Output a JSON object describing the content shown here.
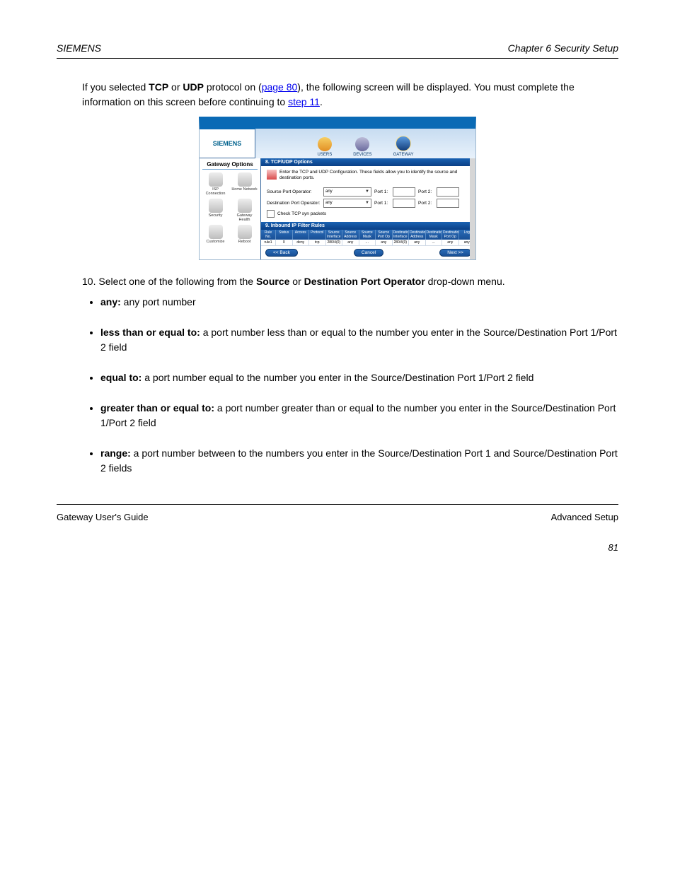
{
  "header": {
    "left": "SIEMENS",
    "right": "Chapter 6  Security Setup"
  },
  "intro": {
    "p1a": "If you selected ",
    "p1b": "TCP",
    "p1c": " or ",
    "p1d": "UDP",
    "p1e": " protocol on (",
    "p1link": "page 80",
    "p1f": "), the following screen will be displayed. You must complete the information on this screen before continuing to ",
    "p1link2": "step 11",
    "p1g": "."
  },
  "screenshot": {
    "logo": "SIEMENS",
    "tabs": {
      "users": "USERS",
      "devices": "DEVICES",
      "gateway": "GATEWAY"
    },
    "sidebar": {
      "title": "Gateway Options",
      "items": [
        "ISP Connection",
        "Home Network",
        "Security",
        "Gateway Health",
        "Customize",
        "Reboot"
      ]
    },
    "bar1": "8.  TCP/UDP Options",
    "note": "Enter the TCP and UDP Configuration. These fields allow you to identify the source and destination ports.",
    "form": {
      "srcLabel": "Source Port Operator:",
      "dstLabel": "Destination Port Operator:",
      "anyOption": "any",
      "port1": "Port 1:",
      "port2": "Port 2:",
      "tcpsyn": "Check TCP syn packets"
    },
    "bar2": "9.  Inbound IP Filter Rules",
    "table": {
      "headers": [
        "Rule No.",
        "Status",
        "Access",
        "Protocol",
        "Source Interface",
        "Source Address",
        "Source Mask",
        "Source Port Op",
        "Destination Interface",
        "Destination Address",
        "Destination Mask",
        "Destination Port Op",
        "Log"
      ],
      "row": [
        "rule1",
        "0",
        "deny",
        "tcp",
        "280/4(0)",
        "any",
        "…",
        "any",
        "280/4(0)",
        "any",
        "…",
        "any",
        "any"
      ]
    },
    "btns": {
      "back": "<< Back",
      "cancel": "Cancel",
      "next": "Next >>"
    }
  },
  "afterText": {
    "step": "10.",
    "lead": " Select one of the following from the ",
    "bold1": "Source",
    "mid1": " or ",
    "bold2": "Destination Port Operator",
    "tail": " drop-down menu.",
    "items": [
      {
        "title": "any:",
        "body": " any port number"
      },
      {
        "title": "less than or equal to:",
        "body": " a port number less than or equal to the number you enter in the Source/Destination Port 1/Port 2 field"
      },
      {
        "title": "equal to:",
        "body": " a port number equal to the number you enter in the Source/Destination Port 1/Port 2 field"
      },
      {
        "title": "greater than or equal to:",
        "body": " a port number greater than or equal to the number you enter in the Source/Destination Port 1/Port 2 field"
      },
      {
        "title": "range:",
        "body": " a port number between to the numbers you enter in the Source/Destination Port 1 and Source/Destination Port 2 fields"
      }
    ]
  },
  "footer": {
    "left": "Gateway User's Guide",
    "right": "Advanced Setup",
    "page": "81"
  }
}
